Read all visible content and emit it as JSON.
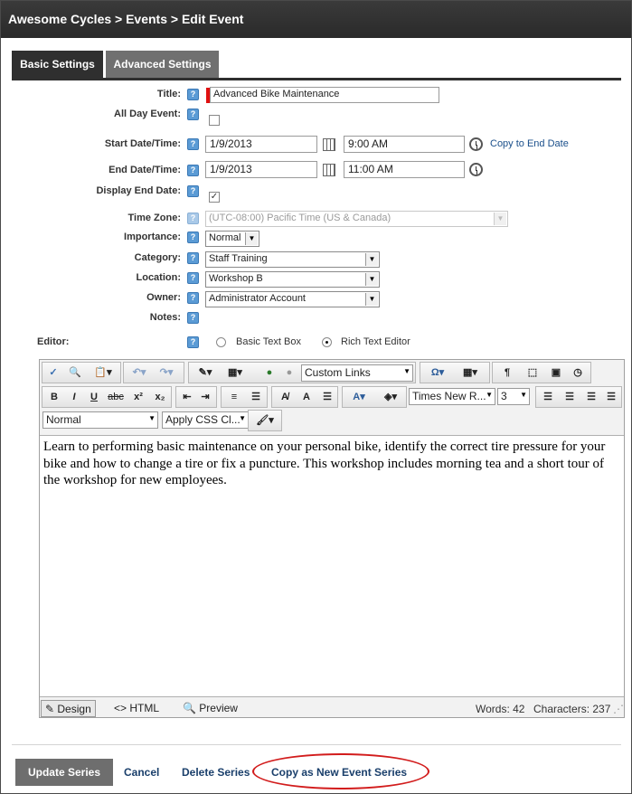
{
  "window": {
    "title": "Awesome Cycles > Events > Edit Event"
  },
  "tabs": [
    {
      "label": "Basic Settings",
      "active": true
    },
    {
      "label": "Advanced Settings",
      "active": false
    }
  ],
  "form": {
    "title": {
      "label": "Title:",
      "value": "Advanced Bike Maintenance"
    },
    "all_day": {
      "label": "All Day Event:",
      "checked": false
    },
    "start": {
      "label": "Start Date/Time:",
      "date": "1/9/2013",
      "time": "9:00 AM",
      "copy_link": "Copy to End Date"
    },
    "end": {
      "label": "End Date/Time:",
      "date": "1/9/2013",
      "time": "11:00 AM"
    },
    "display_end": {
      "label": "Display End Date:",
      "checked": true,
      "mark": "✓"
    },
    "timezone": {
      "label": "Time Zone:",
      "value": "(UTC-08:00) Pacific Time (US & Canada)"
    },
    "importance": {
      "label": "Importance:",
      "value": "Normal"
    },
    "category": {
      "label": "Category:",
      "value": "Staff Training"
    },
    "location": {
      "label": "Location:",
      "value": "Workshop B"
    },
    "owner": {
      "label": "Owner:",
      "value": "Administrator Account"
    },
    "notes": {
      "label": "Notes:"
    },
    "editor_mode": {
      "label": "Editor:",
      "option_basic": "Basic Text Box",
      "option_rich": "Rich Text Editor",
      "selected": "rich"
    }
  },
  "editor": {
    "toolbar": {
      "links_select": "Custom Links",
      "font_name": "Times New R...",
      "font_size": "3",
      "paragraph_style": "Normal",
      "css_class": "Apply CSS Cl..."
    },
    "content": "Learn to performing basic maintenance on your personal bike, identify the correct tire pressure for your bike and how to change a tire or fix a puncture. This workshop includes morning tea and a short tour of the workshop for new employees.",
    "modes": {
      "design": "Design",
      "html": "HTML",
      "preview": "Preview"
    },
    "stats": {
      "words": "Words: 42",
      "characters": "Characters: 237"
    }
  },
  "actions": {
    "update": "Update Series",
    "cancel": "Cancel",
    "delete": "Delete Series",
    "copy_new": "Copy as New Event Series"
  },
  "colors": {
    "titlebar": "#2a2a2a",
    "tab_active": "#2f2f2f",
    "tab_inactive": "#707070",
    "link": "#1a4f8b",
    "highlight": "#d21c1c"
  }
}
